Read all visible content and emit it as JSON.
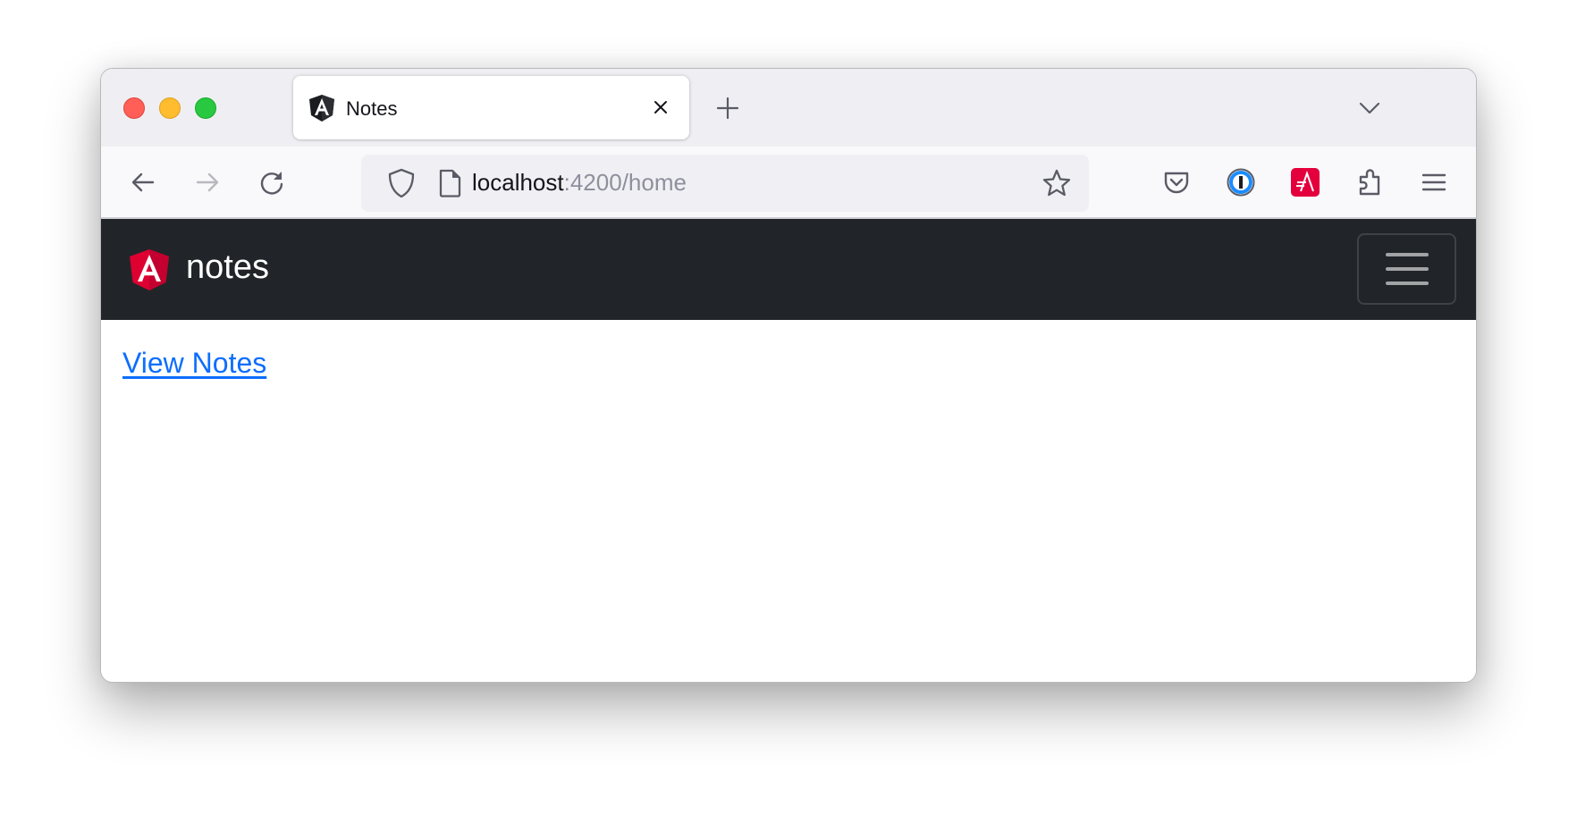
{
  "browser": {
    "window_controls": {
      "close_color": "#ff5f57",
      "minimize_color": "#febc2e",
      "maximize_color": "#28c840"
    },
    "tabs": [
      {
        "title": "Notes",
        "favicon": "angular-icon",
        "active": true
      }
    ],
    "new_tab_icon": "plus-icon",
    "list_all_tabs_icon": "chevron-down-icon",
    "toolbar": {
      "back_icon": "arrow-left-icon",
      "forward_icon": "arrow-right-icon",
      "reload_icon": "reload-icon",
      "url": {
        "host": "localhost",
        "rest": ":4200/home"
      },
      "extensions": [
        "pocket-icon",
        "1password-icon",
        "astro-extension-icon",
        "extensions-puzzle-icon",
        "app-menu-icon"
      ]
    }
  },
  "app": {
    "brand": {
      "name": "notes",
      "logo": "angular-logo"
    },
    "accent_color": "#dd0031",
    "navbar_bg": "#212529",
    "links": [
      {
        "label": "View Notes",
        "color": "#0d6efd"
      }
    ]
  }
}
